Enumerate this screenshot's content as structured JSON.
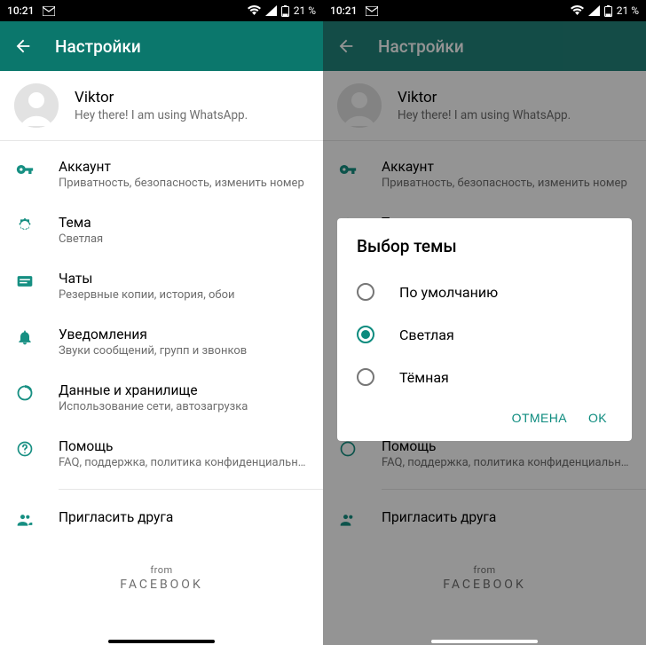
{
  "status": {
    "time": "10:21",
    "battery": "21 %"
  },
  "header": {
    "title": "Настройки"
  },
  "profile": {
    "name": "Viktor",
    "subtitle": "Hey there! I am using WhatsApp."
  },
  "settings": {
    "account": {
      "title": "Аккаунт",
      "sub": "Приватность, безопасность, изменить номер"
    },
    "theme": {
      "title": "Тема",
      "sub": "Светлая"
    },
    "chats": {
      "title": "Чаты",
      "sub": "Резервные копии, история, обои"
    },
    "notif": {
      "title": "Уведомления",
      "sub": "Звуки сообщений, групп и звонков"
    },
    "data": {
      "title": "Данные и хранилище",
      "sub": "Использование сети, автозагрузка"
    },
    "help": {
      "title": "Помощь",
      "sub": "FAQ, поддержка, политика конфиденциально..."
    },
    "invite": {
      "title": "Пригласить друга"
    }
  },
  "footer": {
    "from": "from",
    "brand": "FACEBOOK"
  },
  "dialog": {
    "title": "Выбор темы",
    "options": {
      "default": "По умолчанию",
      "light": "Светлая",
      "dark": "Тёмная"
    },
    "selected": "light",
    "cancel": "ОТМЕНА",
    "ok": "OK"
  }
}
